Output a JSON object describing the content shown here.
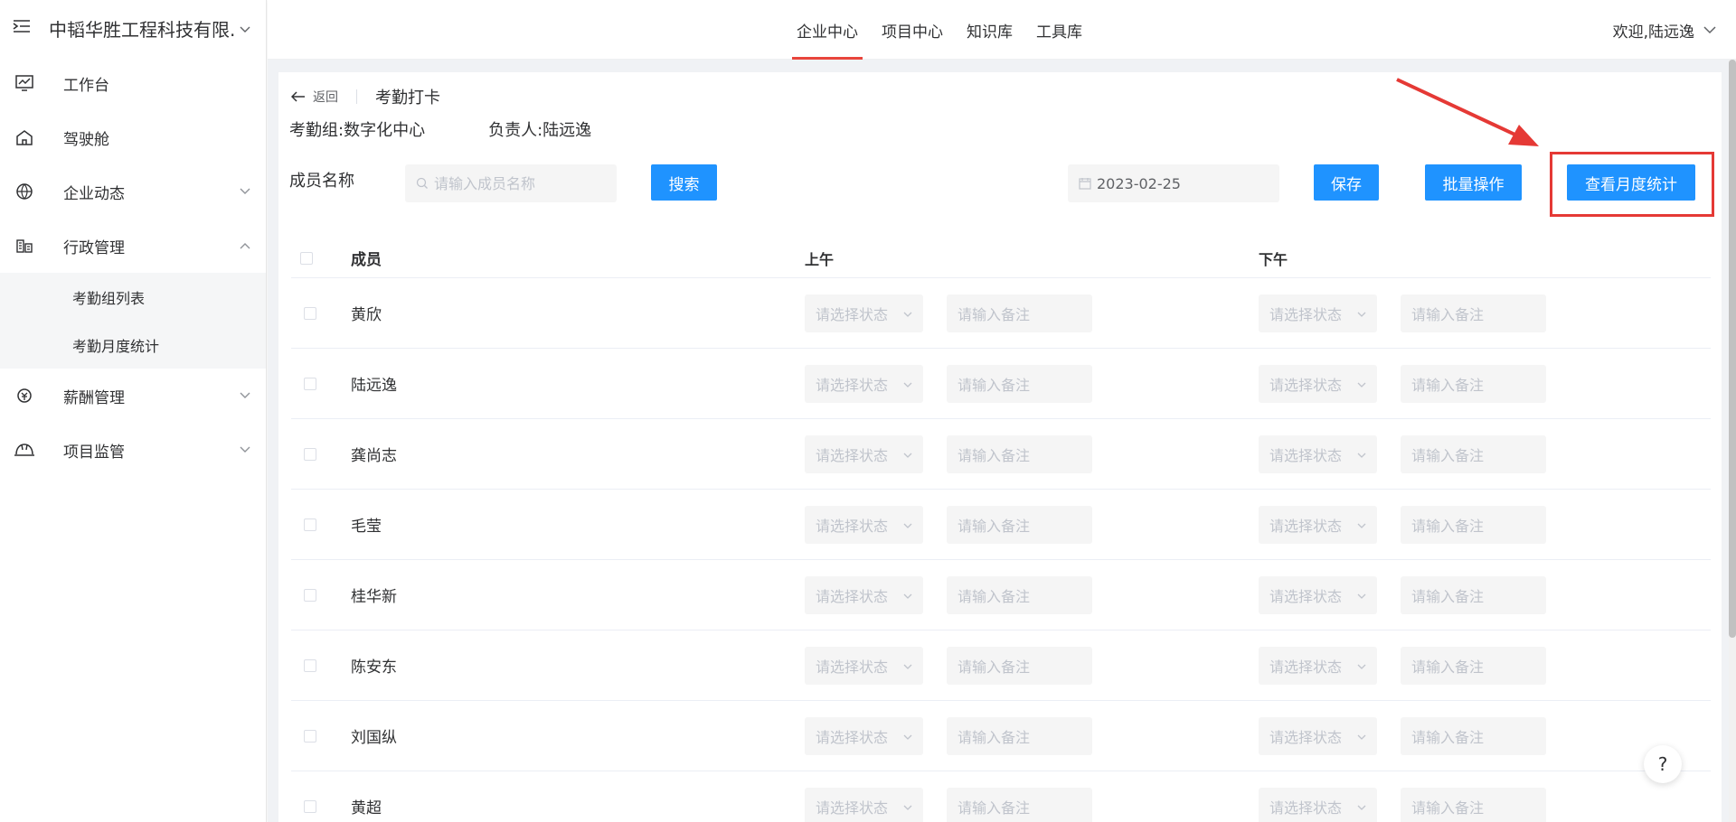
{
  "sidebar": {
    "company": "中韬华胜工程科技有限...",
    "items": [
      {
        "label": "工作台",
        "icon": "monitor-chart-icon"
      },
      {
        "label": "驾驶舱",
        "icon": "home-icon"
      },
      {
        "label": "企业动态",
        "icon": "globe-icon"
      },
      {
        "label": "行政管理",
        "icon": "building-icon"
      },
      {
        "label": "薪酬管理",
        "icon": "salary-icon"
      },
      {
        "label": "项目监管",
        "icon": "helmet-icon"
      }
    ],
    "subitems": [
      {
        "label": "考勤组列表"
      },
      {
        "label": "考勤月度统计"
      }
    ]
  },
  "topnav": {
    "tabs": [
      {
        "label": "企业中心",
        "active": true
      },
      {
        "label": "项目中心"
      },
      {
        "label": "知识库"
      },
      {
        "label": "工具库"
      }
    ],
    "welcome": "欢迎,陆远逸"
  },
  "page": {
    "back_label": "返回",
    "title": "考勤打卡",
    "group": "考勤组:数字化中心",
    "owner": "负责人:陆远逸"
  },
  "filters": {
    "member_label": "成员名称",
    "member_placeholder": "请输入成员名称",
    "search_label": "搜索",
    "date_value": "2023-02-25",
    "save_label": "保存",
    "batch_label": "批量操作",
    "monthly_label": "查看月度统计"
  },
  "table": {
    "headers": {
      "member": "成员",
      "am": "上午",
      "pm": "下午"
    },
    "select_placeholder": "请选择状态",
    "remark_placeholder": "请输入备注",
    "rows": [
      {
        "name": "黄欣"
      },
      {
        "name": "陆远逸"
      },
      {
        "name": "龚尚志"
      },
      {
        "name": "毛莹"
      },
      {
        "name": "桂华新"
      },
      {
        "name": "陈安东"
      },
      {
        "name": "刘国纵"
      },
      {
        "name": "黄超"
      }
    ]
  },
  "help": "?",
  "colors": {
    "primary": "#1f93ff",
    "active_tab": "#e8453c",
    "annotation": "#e53935"
  }
}
